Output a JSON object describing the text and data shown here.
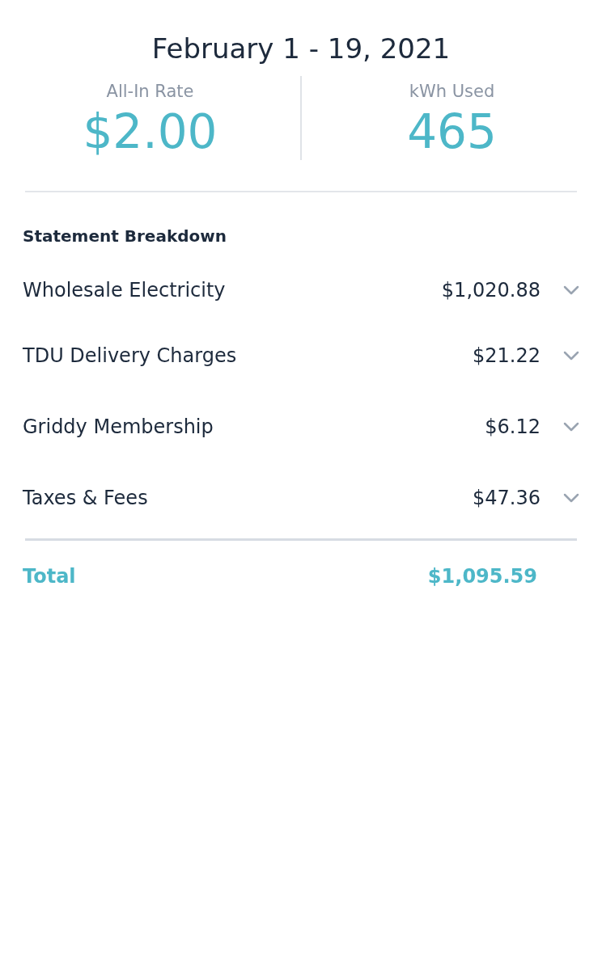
{
  "title": "February 1 - 19, 2021",
  "stats": [
    {
      "label": "All-In Rate",
      "value": "$2.00"
    },
    {
      "label": "kWh Used",
      "value": "465"
    }
  ],
  "breakdown": {
    "heading": "Statement Breakdown",
    "items": [
      {
        "label": "Wholesale Electricity",
        "amount": "$1,020.88"
      },
      {
        "label": "TDU Delivery Charges",
        "amount": "$21.22"
      },
      {
        "label": "Griddy Membership",
        "amount": "$6.12"
      },
      {
        "label": "Taxes & Fees",
        "amount": "$47.36"
      }
    ],
    "total": {
      "label": "Total",
      "amount": "$1,095.59"
    }
  }
}
